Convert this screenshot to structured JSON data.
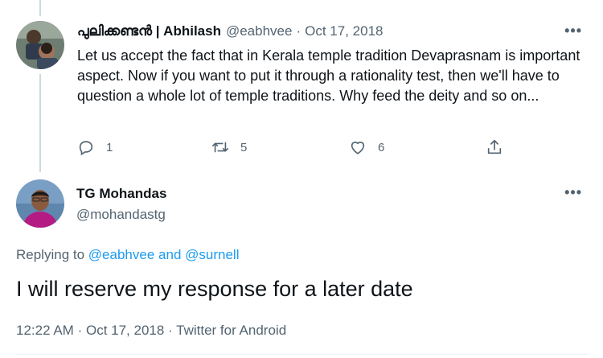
{
  "tweet1": {
    "display_name": "പുലിക്കണ്ടൻ | Abhilash",
    "handle": "@eabhvee",
    "separator": "·",
    "date": "Oct 17, 2018",
    "more_icon": "more-horizontal-icon",
    "text": "Let us accept the fact that in Kerala temple tradition Devaprasnam is important aspect. Now if you want to put it through a rationality test, then we'll have to question a whole lot of temple traditions. Why feed the deity and so on...",
    "actions": {
      "reply_count": "1",
      "retweet_count": "5",
      "like_count": "6"
    }
  },
  "tweet2": {
    "display_name": "TG Mohandas",
    "handle": "@mohandastg",
    "replying_prefix": "Replying to",
    "replying_user1": "@eabhvee",
    "replying_and": "and",
    "replying_user2": "@surnell",
    "text": "I will reserve my response for a later date",
    "time": "12:22 AM",
    "separator": "·",
    "date": "Oct 17, 2018",
    "source": "Twitter for Android"
  },
  "colors": {
    "text_primary": "#0f1419",
    "text_secondary": "#536471",
    "link": "#1d9bf0",
    "thread_line": "#cfd9de"
  }
}
